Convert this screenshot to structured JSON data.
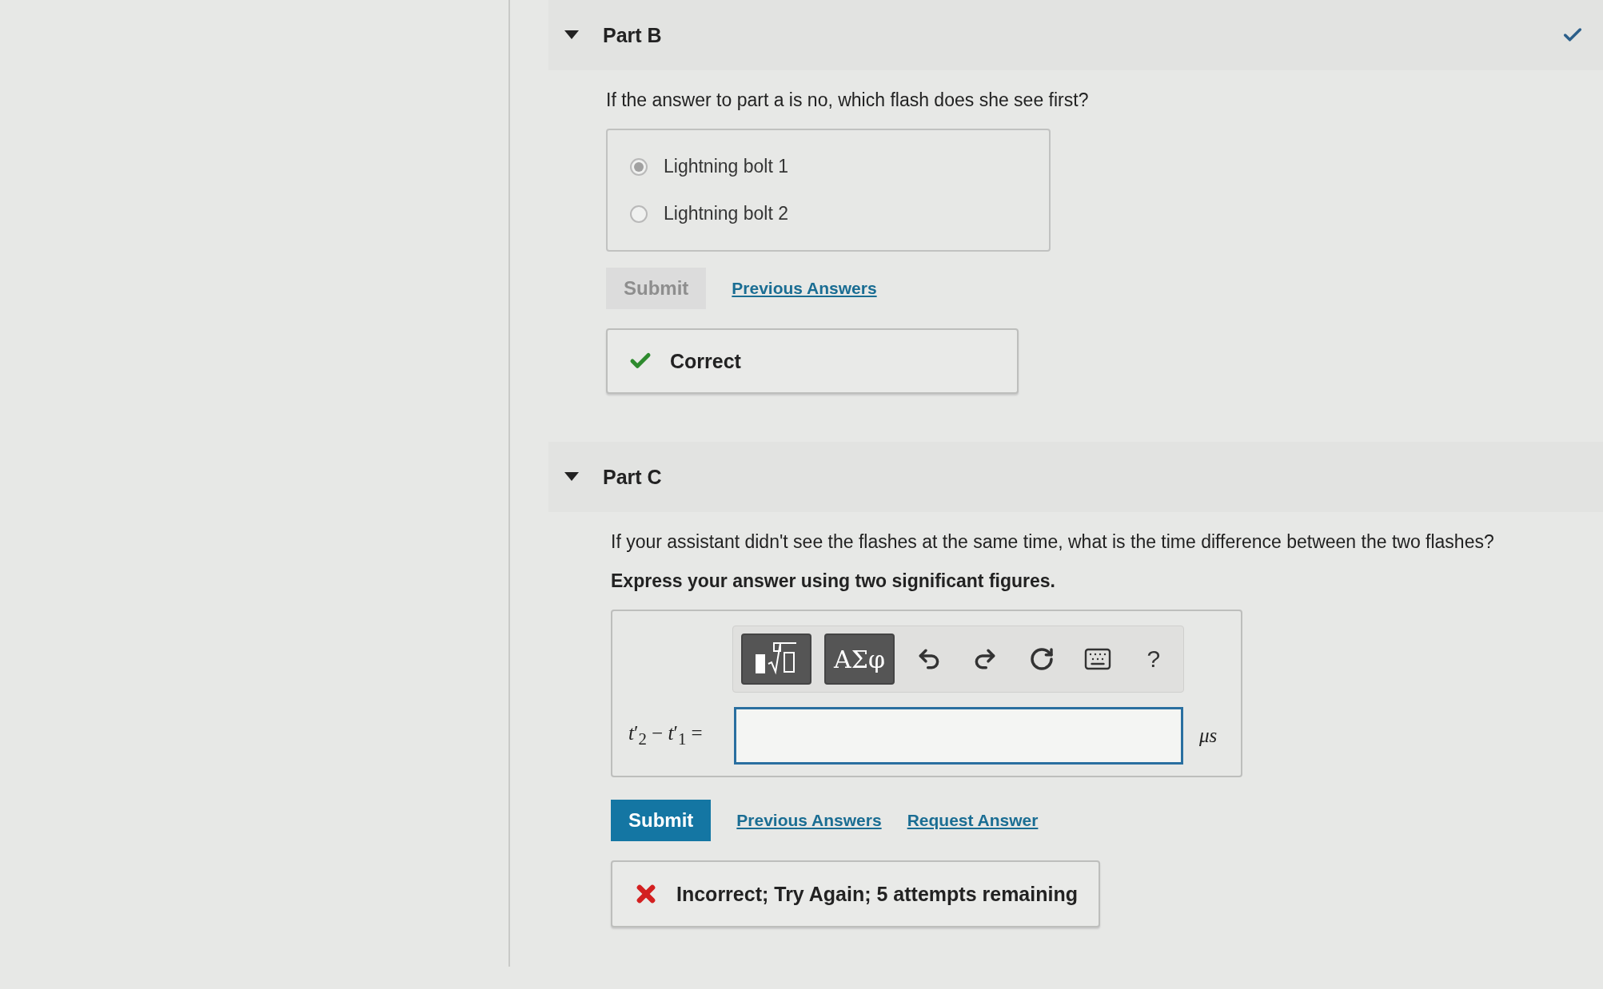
{
  "part_b": {
    "title": "Part B",
    "expanded": true,
    "completed": true,
    "question": "If the answer to part a is no, which flash does she see first?",
    "disabled": true,
    "options": [
      {
        "label": "Lightning bolt 1",
        "selected": true
      },
      {
        "label": "Lightning bolt 2",
        "selected": false
      }
    ],
    "submit": {
      "label": "Submit",
      "disabled": true
    },
    "links": [
      "Previous Answers"
    ],
    "feedback": {
      "kind": "correct",
      "text": "Correct"
    }
  },
  "part_c": {
    "title": "Part C",
    "expanded": true,
    "question": "If your assistant didn't see the flashes at the same time, what is the time difference between the two flashes?",
    "instruction": "Express your answer using two significant figures.",
    "toolbar": [
      {
        "kind": "templates"
      },
      {
        "kind": "symbols",
        "label": "ΑΣφ"
      },
      {
        "kind": "undo"
      },
      {
        "kind": "redo"
      },
      {
        "kind": "reset"
      },
      {
        "kind": "keyboard"
      },
      {
        "kind": "help",
        "label": "?"
      }
    ],
    "equation_label": "*t*′$_{2}$ − *t*′$_{1}$ =",
    "unit": "μs",
    "submit": {
      "label": "Submit",
      "disabled": false
    },
    "links": [
      "Previous Answers",
      "Request Answer"
    ],
    "feedback": {
      "kind": "incorrect",
      "text": "Incorrect; Try Again; 5 attempts remaining"
    }
  }
}
